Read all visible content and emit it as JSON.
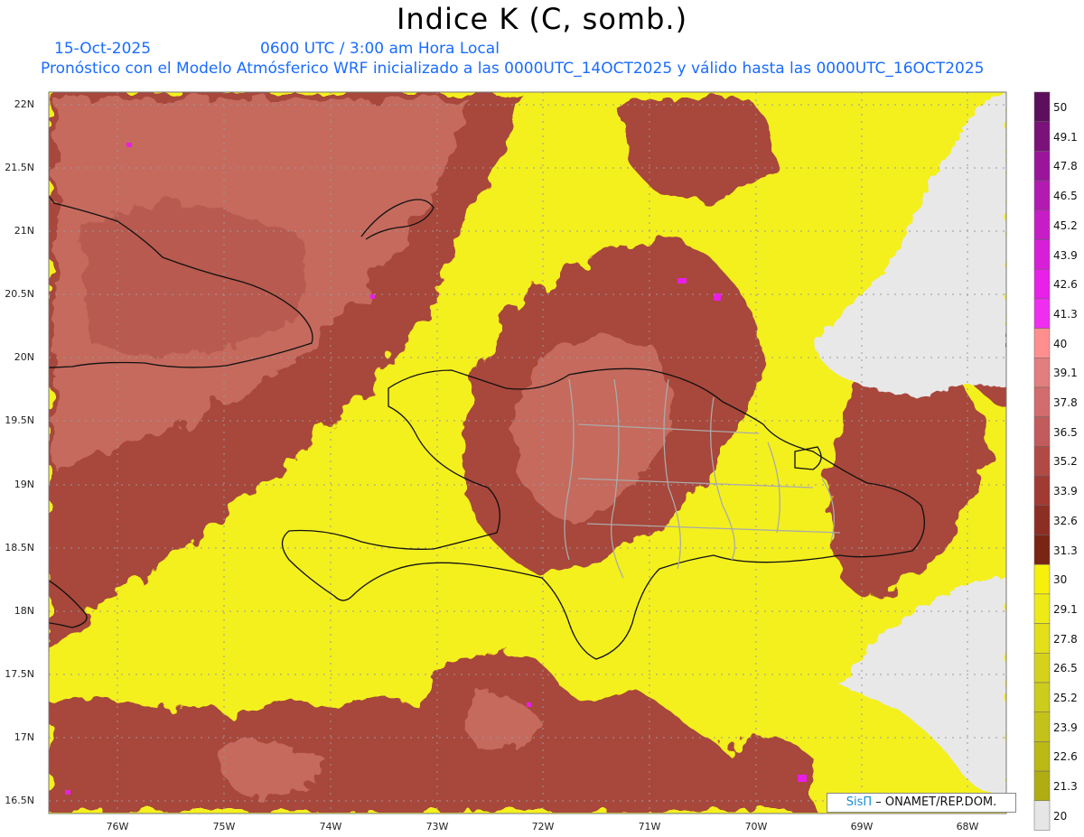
{
  "header": {
    "title": "Indice K (C, somb.)",
    "date": "15-Oct-2025",
    "time": "0600 UTC / 3:00 am Hora Local",
    "description": "Pronóstico con el Modelo Atmósferico WRF inicializado a las 0000UTC_14OCT2025 y válido hasta las  0000UTC_16OCT2025"
  },
  "axes": {
    "lat_labels": [
      "22N",
      "21.5N",
      "21N",
      "20.5N",
      "20N",
      "19.5N",
      "19N",
      "18.5N",
      "18N",
      "17.5N",
      "17N",
      "16.5N"
    ],
    "lon_labels": [
      "76W",
      "75W",
      "74W",
      "73W",
      "72W",
      "71W",
      "70W",
      "69W",
      "68W"
    ]
  },
  "colorbar": {
    "levels": [
      "50",
      "49.1",
      "47.8",
      "46.5",
      "45.2",
      "43.9",
      "42.6",
      "41.3",
      "40",
      "39.1",
      "37.8",
      "36.5",
      "35.2",
      "33.9",
      "32.6",
      "31.3",
      "30",
      "29.1",
      "27.8",
      "26.5",
      "25.2",
      "23.9",
      "22.6",
      "21.3",
      "20"
    ],
    "colors": [
      "#5c0f5c",
      "#7a127a",
      "#9a159a",
      "#b21ab2",
      "#c61dc6",
      "#d81fd8",
      "#e820e8",
      "#f02ef0",
      "#ff8f8f",
      "#e27e7e",
      "#d26c6c",
      "#c25b5b",
      "#b14a45",
      "#a03a33",
      "#8d2e24",
      "#7a2414",
      "#f7f00c",
      "#eeea18",
      "#e2de1a",
      "#d6d21c",
      "#cccc1c",
      "#c4c21a",
      "#bbb816",
      "#b0ad12",
      "#e6e6e6"
    ]
  },
  "credit": {
    "brand": "SisΠ",
    "text": " – ONAMET/REP.DOM."
  },
  "colors": {
    "yellow": "#f4f01e",
    "brown": "#a2483a",
    "rose": "#c76a5e",
    "land": "#e8e8e8",
    "grid": "#9a9a9a"
  }
}
